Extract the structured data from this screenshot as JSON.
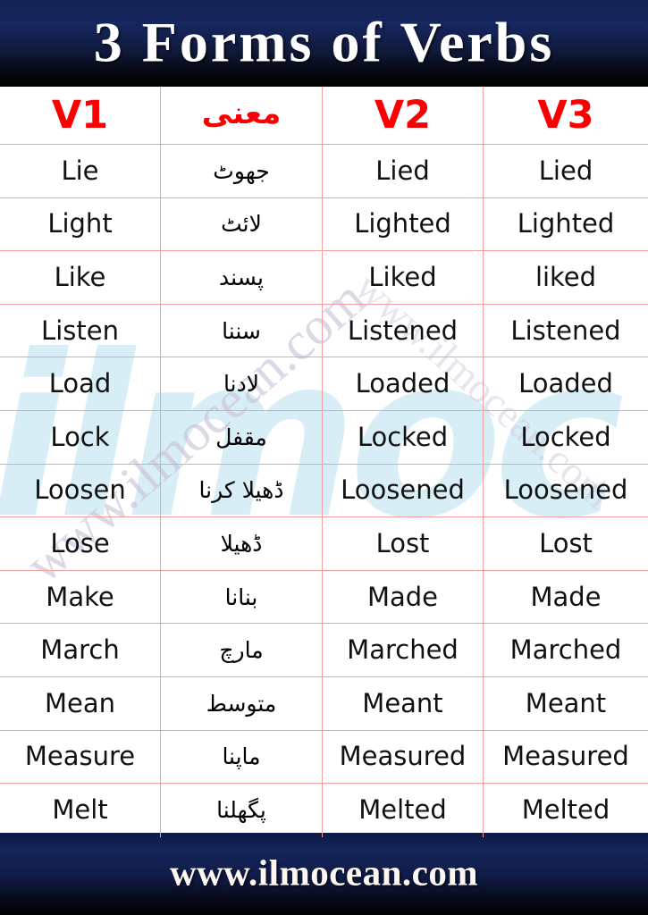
{
  "banner": {
    "title": "3 Forms of Verbs",
    "background_top_color": "#132154",
    "background_bottom_color": "#000000",
    "text_color": "#ffffff"
  },
  "footer": {
    "text": "www.ilmocean.com",
    "background_top_color": "#0d1a45",
    "background_bottom_color": "#000000",
    "text_color": "#fdf7f2"
  },
  "watermark": {
    "logo_text": "ilmoc",
    "logo_color": "#bfe4f2",
    "url_text": "www.ilmocean.com",
    "url_text_2": "www.ilmocean.com",
    "url_color": "#cbbfd8"
  },
  "table": {
    "header_color": "#fb0000",
    "grid_color": "#f5a0a0",
    "columns": [
      {
        "key": "v1",
        "label": "V1"
      },
      {
        "key": "meaning",
        "label": "معنی"
      },
      {
        "key": "v2",
        "label": "V2"
      },
      {
        "key": "v3",
        "label": "V3"
      }
    ],
    "rows": [
      {
        "v1": "Lie",
        "meaning": "جھوٹ",
        "v2": "Lied",
        "v3": "Lied"
      },
      {
        "v1": "Light",
        "meaning": "لائٹ",
        "v2": "Lighted",
        "v3": "Lighted"
      },
      {
        "v1": "Like",
        "meaning": "پسند",
        "v2": "Liked",
        "v3": "liked"
      },
      {
        "v1": "Listen",
        "meaning": "سننا",
        "v2": "Listened",
        "v3": "Listened"
      },
      {
        "v1": "Load",
        "meaning": "لادنا",
        "v2": "Loaded",
        "v3": "Loaded"
      },
      {
        "v1": "Lock",
        "meaning": "مقفل",
        "v2": "Locked",
        "v3": "Locked"
      },
      {
        "v1": "Loosen",
        "meaning": "ڈھیلا کرنا",
        "v2": "Loosened",
        "v3": "Loosened"
      },
      {
        "v1": "Lose",
        "meaning": "ڈھیلا",
        "v2": "Lost",
        "v3": "Lost"
      },
      {
        "v1": "Make",
        "meaning": "بنانا",
        "v2": "Made",
        "v3": "Made"
      },
      {
        "v1": "March",
        "meaning": "مارچ",
        "v2": "Marched",
        "v3": "Marched"
      },
      {
        "v1": "Mean",
        "meaning": "متوسط",
        "v2": "Meant",
        "v3": "Meant"
      },
      {
        "v1": "Measure",
        "meaning": "ماپنا",
        "v2": "Measured",
        "v3": "Measured"
      },
      {
        "v1": "Melt",
        "meaning": "پگھلنا",
        "v2": "Melted",
        "v3": "Melted"
      }
    ]
  }
}
